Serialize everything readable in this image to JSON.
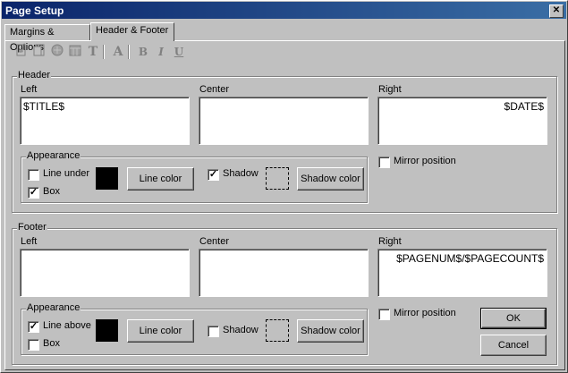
{
  "window": {
    "title": "Page Setup",
    "close_glyph": "✕"
  },
  "tabs": [
    {
      "label": "Margins & Options"
    },
    {
      "label": "Header & Footer"
    }
  ],
  "toolbar": {
    "icons": [
      "insert-page-icon",
      "insert-pagecount-icon",
      "insert-date-icon",
      "insert-time-icon",
      "insert-title-icon",
      "font-icon",
      "bold-icon",
      "italic-icon",
      "underline-icon"
    ],
    "glyphs": {
      "title": "T",
      "font": "A",
      "bold": "B",
      "italic": "I",
      "underline": "U"
    }
  },
  "header": {
    "group_label": "Header",
    "left_label": "Left",
    "center_label": "Center",
    "right_label": "Right",
    "left_value": "$TITLE$",
    "center_value": "",
    "right_value": "$DATE$",
    "appearance_label": "Appearance",
    "line_label": "Line under",
    "line_checked": false,
    "box_label": "Box",
    "box_checked": true,
    "line_color_button": "Line color",
    "shadow_label": "Shadow",
    "shadow_checked": true,
    "shadow_color_button": "Shadow color",
    "mirror_label": "Mirror position",
    "mirror_checked": false,
    "line_color": "#000000"
  },
  "footer": {
    "group_label": "Footer",
    "left_label": "Left",
    "center_label": "Center",
    "right_label": "Right",
    "left_value": "",
    "center_value": "",
    "right_value": "$PAGENUM$/$PAGECOUNT$",
    "appearance_label": "Appearance",
    "line_label": "Line above",
    "line_checked": true,
    "box_label": "Box",
    "box_checked": false,
    "line_color_button": "Line color",
    "shadow_label": "Shadow",
    "shadow_checked": false,
    "shadow_color_button": "Shadow color",
    "mirror_label": "Mirror position",
    "mirror_checked": false,
    "line_color": "#000000"
  },
  "buttons": {
    "ok": "OK",
    "cancel": "Cancel"
  },
  "check_glyph": "✓"
}
